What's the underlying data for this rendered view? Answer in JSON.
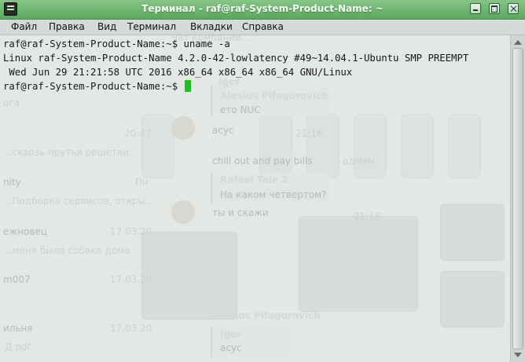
{
  "window": {
    "title": "Терминал - raf@raf-System-Product-Name: ~",
    "icon": "terminal-icon",
    "accent": "#6ab56c"
  },
  "menu": [
    {
      "label": "Файл"
    },
    {
      "label": "Правка"
    },
    {
      "label": "Вид"
    },
    {
      "label": "Терминал"
    },
    {
      "label": "Вкладки"
    },
    {
      "label": "Справка"
    }
  ],
  "terminal": {
    "lines": [
      "raf@raf-System-Product-Name:~$ uname -a",
      "Linux raf-System-Product-Name 4.2.0-42-lowlatency #49~14.04.1-Ubuntu SMP PREEMPT",
      " Wed Jun 29 21:21:58 UTC 2016 x86_64 x86_64 x86_64 GNU/Linux",
      "raf@raf-System-Product-Name:~$ "
    ],
    "cursor_color": "#1fbf1f"
  },
  "background_ghost": {
    "header": "Чат компании...",
    "items": [
      {
        "text": "Igor"
      },
      {
        "text": "Alexios Pifagorovich"
      },
      {
        "text": "ето NUC"
      },
      {
        "text": "асус"
      },
      {
        "text": "20:47"
      },
      {
        "text": "21:16"
      },
      {
        "text": "...сквозь прутья решетки."
      },
      {
        "text": "chill out and pay bills"
      },
      {
        "text": "админ"
      },
      {
        "text": "nity"
      },
      {
        "text": "Пн"
      },
      {
        "text": "Rafael Tele 2"
      },
      {
        "text": "На каком четвертом?"
      },
      {
        "text": "...Подборка сервисов, откры..."
      },
      {
        "text": "ты и скажи"
      },
      {
        "text": "21:16"
      },
      {
        "text": "ежновец"
      },
      {
        "text": "17.03.20"
      },
      {
        "text": "...меня была собака дома"
      },
      {
        "text": "m007"
      },
      {
        "text": "17.03.20"
      },
      {
        "text": "ильня"
      },
      {
        "text": "17.03.20"
      },
      {
        "text": "Alexios Pifagorovich"
      },
      {
        "text": "Igor"
      },
      {
        "text": "асус"
      },
      {
        "text": "Д.pdf"
      },
      {
        "text": "ога"
      }
    ]
  }
}
